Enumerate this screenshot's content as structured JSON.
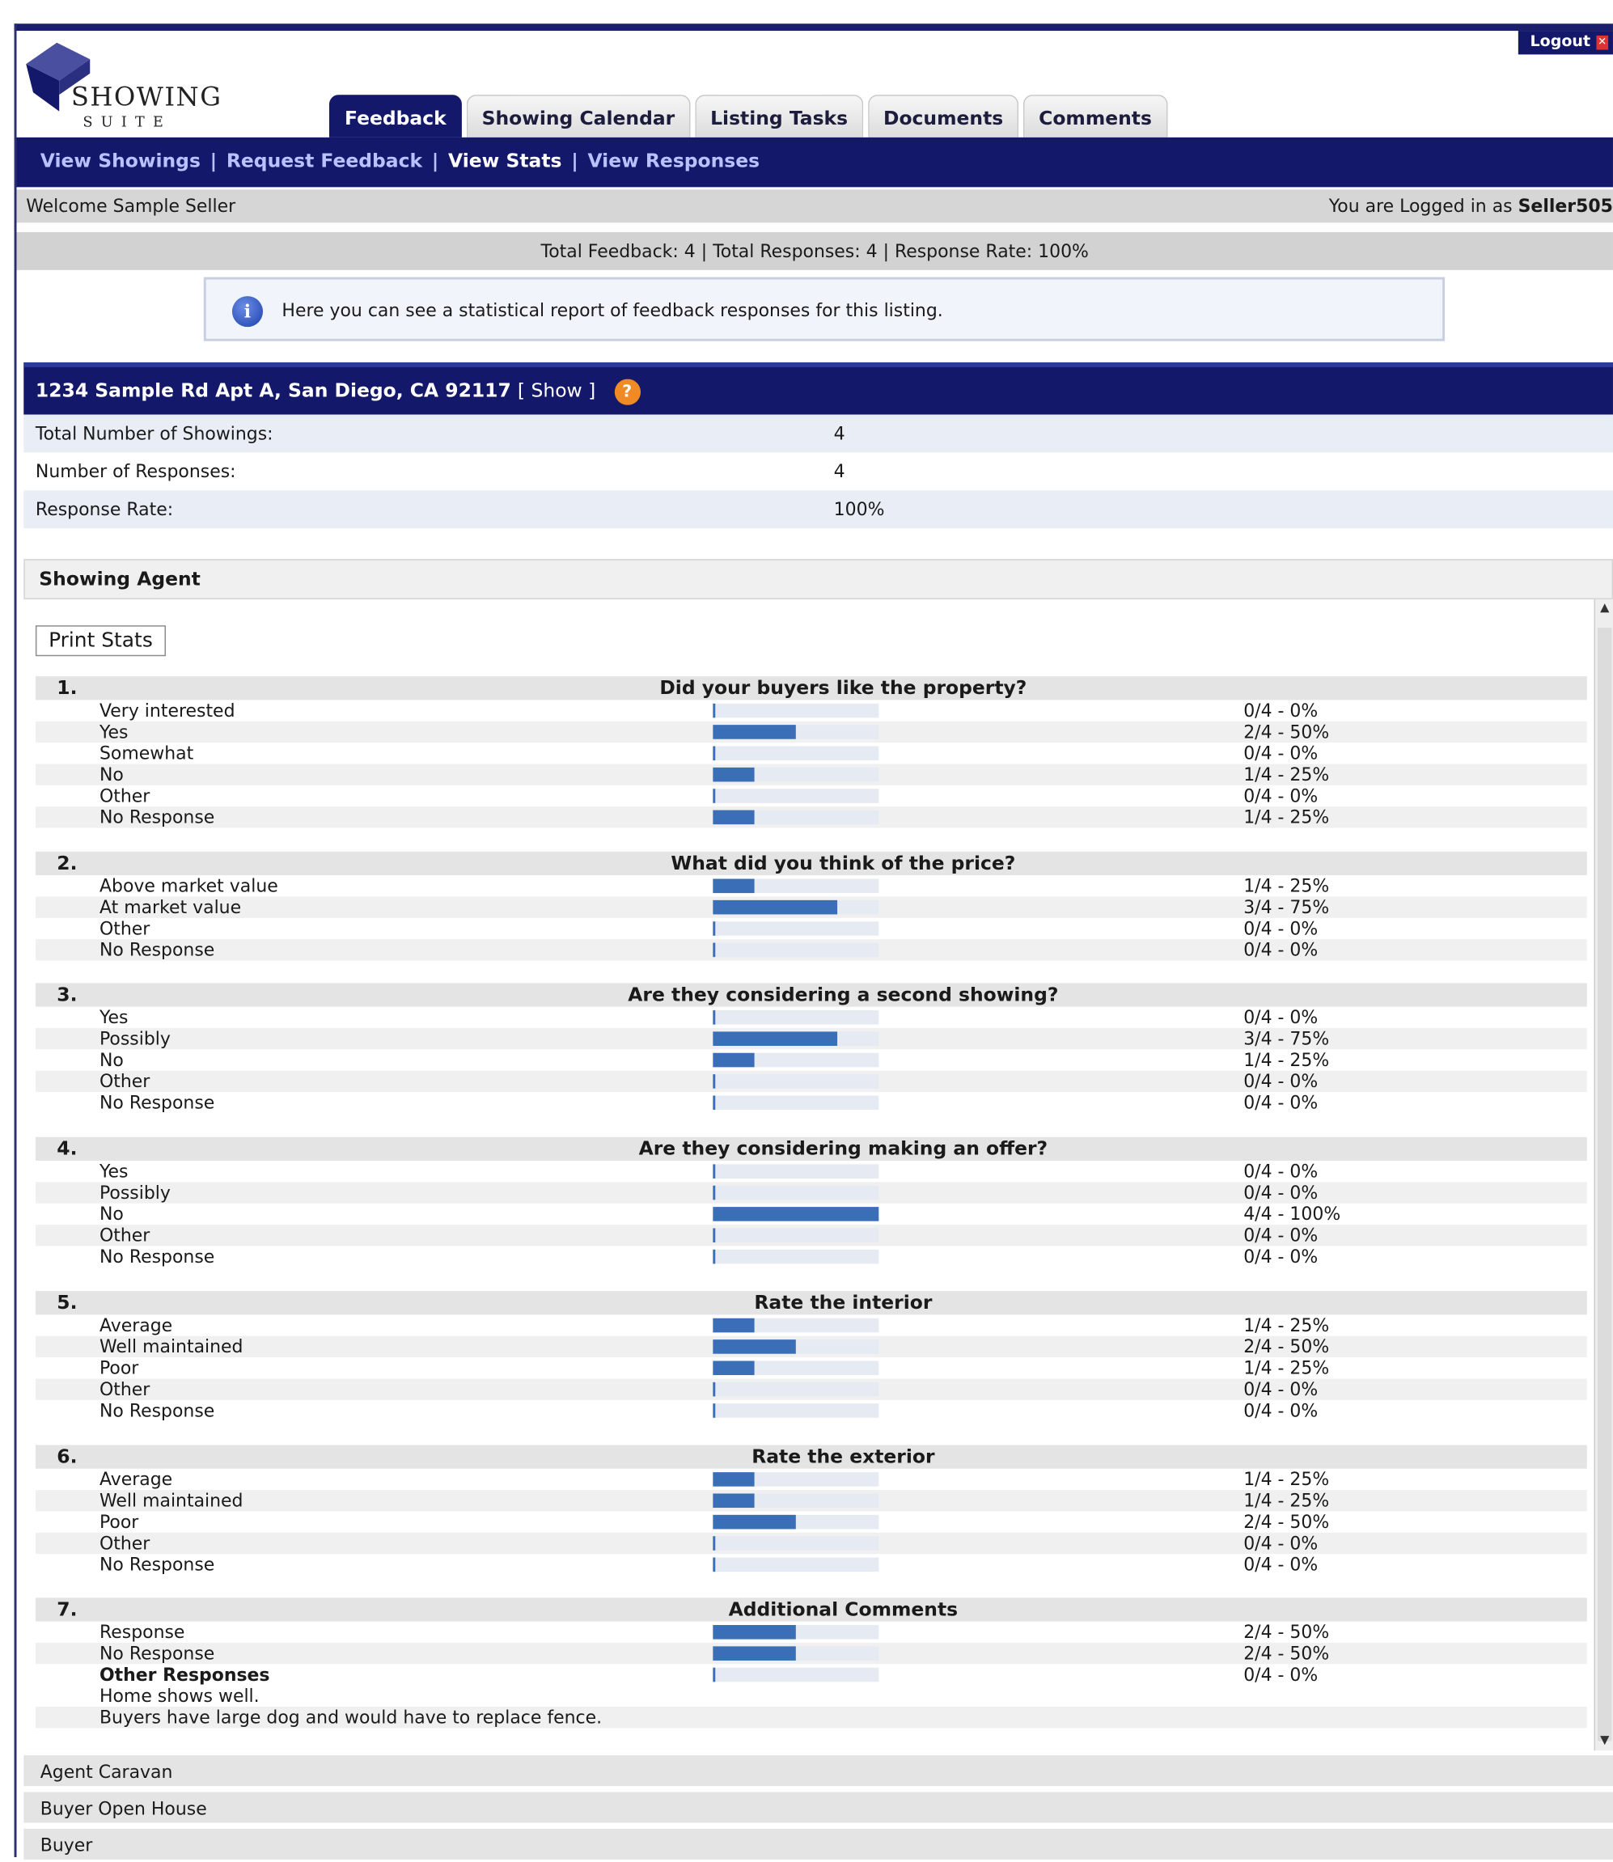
{
  "header": {
    "logout_label": "Logout",
    "logo_main": "SHOWING",
    "logo_sub": "SUITE"
  },
  "tabs": [
    {
      "label": "Feedback",
      "active": true
    },
    {
      "label": "Showing Calendar"
    },
    {
      "label": "Listing Tasks"
    },
    {
      "label": "Documents"
    },
    {
      "label": "Comments"
    }
  ],
  "subnav": [
    "View Showings",
    "Request Feedback",
    "View Stats",
    "View Responses"
  ],
  "welcome": {
    "left": "Welcome Sample Seller",
    "right_prefix": "You are Logged in as",
    "username": "Seller505"
  },
  "totals_text": "Total Feedback: 4 | Total Responses: 4 | Response Rate: 100%",
  "info_text": "Here you can see a statistical report of feedback responses for this listing.",
  "listing": {
    "address": "1234 Sample Rd Apt A, San Diego, CA 92117",
    "show_link": "[ Show ]",
    "stats": [
      {
        "label": "Total Number of Showings:",
        "value": "4"
      },
      {
        "label": "Number of Responses:",
        "value": "4"
      },
      {
        "label": "Response Rate:",
        "value": "100%"
      }
    ]
  },
  "section_title": "Showing Agent",
  "print_label": "Print Stats",
  "questions": [
    {
      "num": "1.",
      "title": "Did your buyers like the property?",
      "options": [
        {
          "label": "Very interested",
          "fraction": 0,
          "text": "0/4 - 0%"
        },
        {
          "label": "Yes",
          "fraction": 0.5,
          "text": "2/4 - 50%"
        },
        {
          "label": "Somewhat",
          "fraction": 0,
          "text": "0/4 - 0%"
        },
        {
          "label": "No",
          "fraction": 0.25,
          "text": "1/4 - 25%"
        },
        {
          "label": "Other",
          "fraction": 0,
          "text": "0/4 - 0%"
        },
        {
          "label": "No Response",
          "fraction": 0.25,
          "text": "1/4 - 25%"
        }
      ]
    },
    {
      "num": "2.",
      "title": "What did you think of the price?",
      "options": [
        {
          "label": "Above market value",
          "fraction": 0.25,
          "text": "1/4 - 25%"
        },
        {
          "label": "At market value",
          "fraction": 0.75,
          "text": "3/4 - 75%"
        },
        {
          "label": "Other",
          "fraction": 0,
          "text": "0/4 - 0%"
        },
        {
          "label": "No Response",
          "fraction": 0,
          "text": "0/4 - 0%"
        }
      ]
    },
    {
      "num": "3.",
      "title": "Are they considering a second showing?",
      "options": [
        {
          "label": "Yes",
          "fraction": 0,
          "text": "0/4 - 0%"
        },
        {
          "label": "Possibly",
          "fraction": 0.75,
          "text": "3/4 - 75%"
        },
        {
          "label": "No",
          "fraction": 0.25,
          "text": "1/4 - 25%"
        },
        {
          "label": "Other",
          "fraction": 0,
          "text": "0/4 - 0%"
        },
        {
          "label": "No Response",
          "fraction": 0,
          "text": "0/4 - 0%"
        }
      ]
    },
    {
      "num": "4.",
      "title": "Are they considering making an offer?",
      "options": [
        {
          "label": "Yes",
          "fraction": 0,
          "text": "0/4 - 0%"
        },
        {
          "label": "Possibly",
          "fraction": 0,
          "text": "0/4 - 0%"
        },
        {
          "label": "No",
          "fraction": 1,
          "text": "4/4 - 100%"
        },
        {
          "label": "Other",
          "fraction": 0,
          "text": "0/4 - 0%"
        },
        {
          "label": "No Response",
          "fraction": 0,
          "text": "0/4 - 0%"
        }
      ]
    },
    {
      "num": "5.",
      "title": "Rate the interior",
      "options": [
        {
          "label": "Average",
          "fraction": 0.25,
          "text": "1/4 - 25%"
        },
        {
          "label": "Well maintained",
          "fraction": 0.5,
          "text": "2/4 - 50%"
        },
        {
          "label": "Poor",
          "fraction": 0.25,
          "text": "1/4 - 25%"
        },
        {
          "label": "Other",
          "fraction": 0,
          "text": "0/4 - 0%"
        },
        {
          "label": "No Response",
          "fraction": 0,
          "text": "0/4 - 0%"
        }
      ]
    },
    {
      "num": "6.",
      "title": "Rate the exterior",
      "options": [
        {
          "label": "Average",
          "fraction": 0.25,
          "text": "1/4 - 25%"
        },
        {
          "label": "Well maintained",
          "fraction": 0.25,
          "text": "1/4 - 25%"
        },
        {
          "label": "Poor",
          "fraction": 0.5,
          "text": "2/4 - 50%"
        },
        {
          "label": "Other",
          "fraction": 0,
          "text": "0/4 - 0%"
        },
        {
          "label": "No Response",
          "fraction": 0,
          "text": "0/4 - 0%"
        }
      ]
    },
    {
      "num": "7.",
      "title": "Additional Comments",
      "options": [
        {
          "label": "Response",
          "fraction": 0.5,
          "text": "2/4 - 50%"
        },
        {
          "label": "No Response",
          "fraction": 0.5,
          "text": "2/4 - 50%"
        },
        {
          "label": "Other Responses",
          "fraction": 0,
          "text": "0/4 - 0%",
          "bold": true
        }
      ],
      "comments": [
        "Home shows well.",
        "Buyers have large dog and would have to replace fence."
      ]
    }
  ],
  "footer_sections": [
    "Agent Caravan",
    "Buyer Open House",
    "Buyer"
  ],
  "colors": {
    "navy": "#14186a",
    "bar": "#3a6fb8",
    "help_icon": "#f08a24",
    "info_icon": "#1c3fa8"
  }
}
